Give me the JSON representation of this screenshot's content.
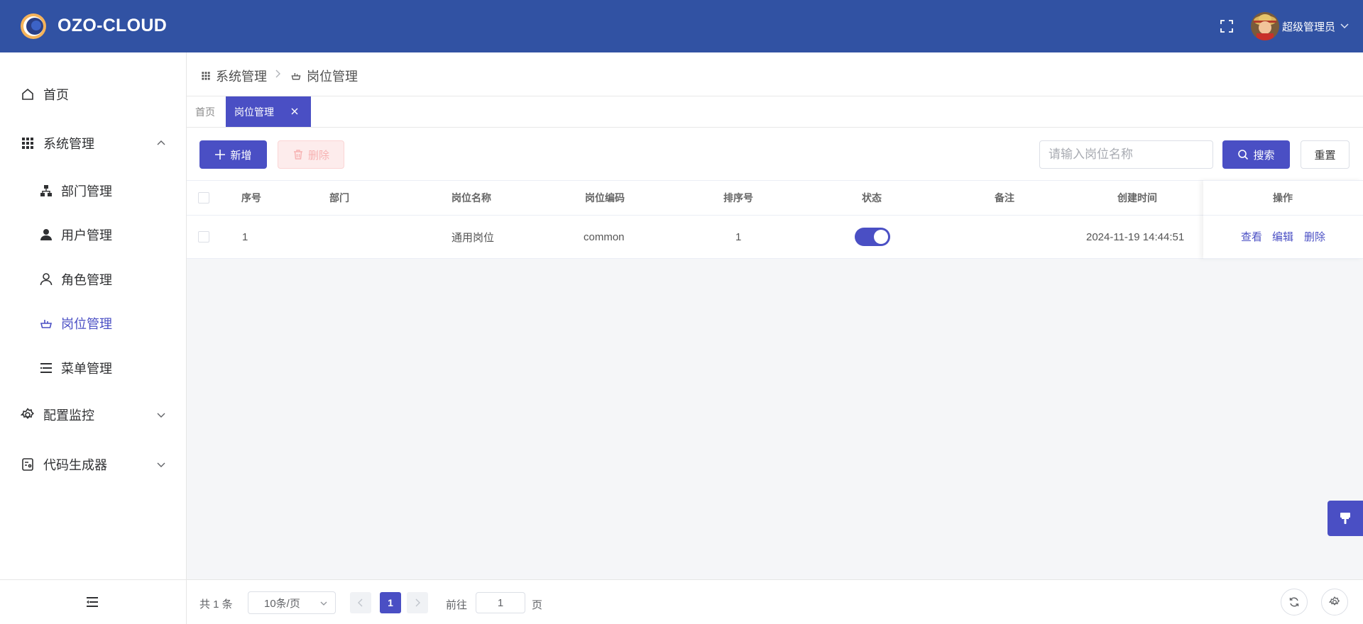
{
  "app": {
    "title": "OZO-CLOUD",
    "user_name": "超级管理员",
    "brand_color": "#3152a3",
    "accent_color": "#4a4fc4"
  },
  "sidebar": {
    "items": [
      {
        "label": "首页",
        "icon": "home-icon"
      },
      {
        "label": "系统管理",
        "icon": "grid-icon",
        "expanded": true
      },
      {
        "label": "部门管理",
        "icon": "org-chart-icon"
      },
      {
        "label": "用户管理",
        "icon": "user-filled-icon"
      },
      {
        "label": "角色管理",
        "icon": "user-outline-icon"
      },
      {
        "label": "岗位管理",
        "icon": "post-icon",
        "active": true
      },
      {
        "label": "菜单管理",
        "icon": "menu-list-icon"
      },
      {
        "label": "配置监控",
        "icon": "gear-icon",
        "expanded": false
      },
      {
        "label": "代码生成器",
        "icon": "code-generator-icon",
        "expanded": false
      }
    ]
  },
  "breadcrumb": {
    "items": [
      {
        "label": "系统管理",
        "icon": "grid-icon"
      },
      {
        "label": "岗位管理",
        "icon": "post-icon"
      }
    ]
  },
  "tabs": [
    {
      "label": "首页",
      "active": false
    },
    {
      "label": "岗位管理",
      "active": true,
      "closable": true
    }
  ],
  "toolbar": {
    "add_label": "新增",
    "delete_label": "删除",
    "search_placeholder": "请输入岗位名称",
    "search_value": "",
    "search_label": "搜索",
    "reset_label": "重置"
  },
  "table": {
    "headers": {
      "index": "序号",
      "dept": "部门",
      "post_name": "岗位名称",
      "post_code": "岗位编码",
      "sort": "排序号",
      "status": "状态",
      "remark": "备注",
      "created": "创建时间",
      "ops": "操作"
    },
    "rows": [
      {
        "index": "1",
        "dept": "",
        "post_name": "通用岗位",
        "post_code": "common",
        "sort": "1",
        "status": true,
        "remark": "",
        "created": "2024-11-19 14:44:51",
        "actions": {
          "view": "查看",
          "edit": "编辑",
          "delete": "删除"
        }
      }
    ]
  },
  "pagination": {
    "total_text": "共 1 条",
    "page_size": "10条/页",
    "current_page": "1",
    "goto_label": "前往",
    "goto_value": "1",
    "page_suffix": "页"
  }
}
